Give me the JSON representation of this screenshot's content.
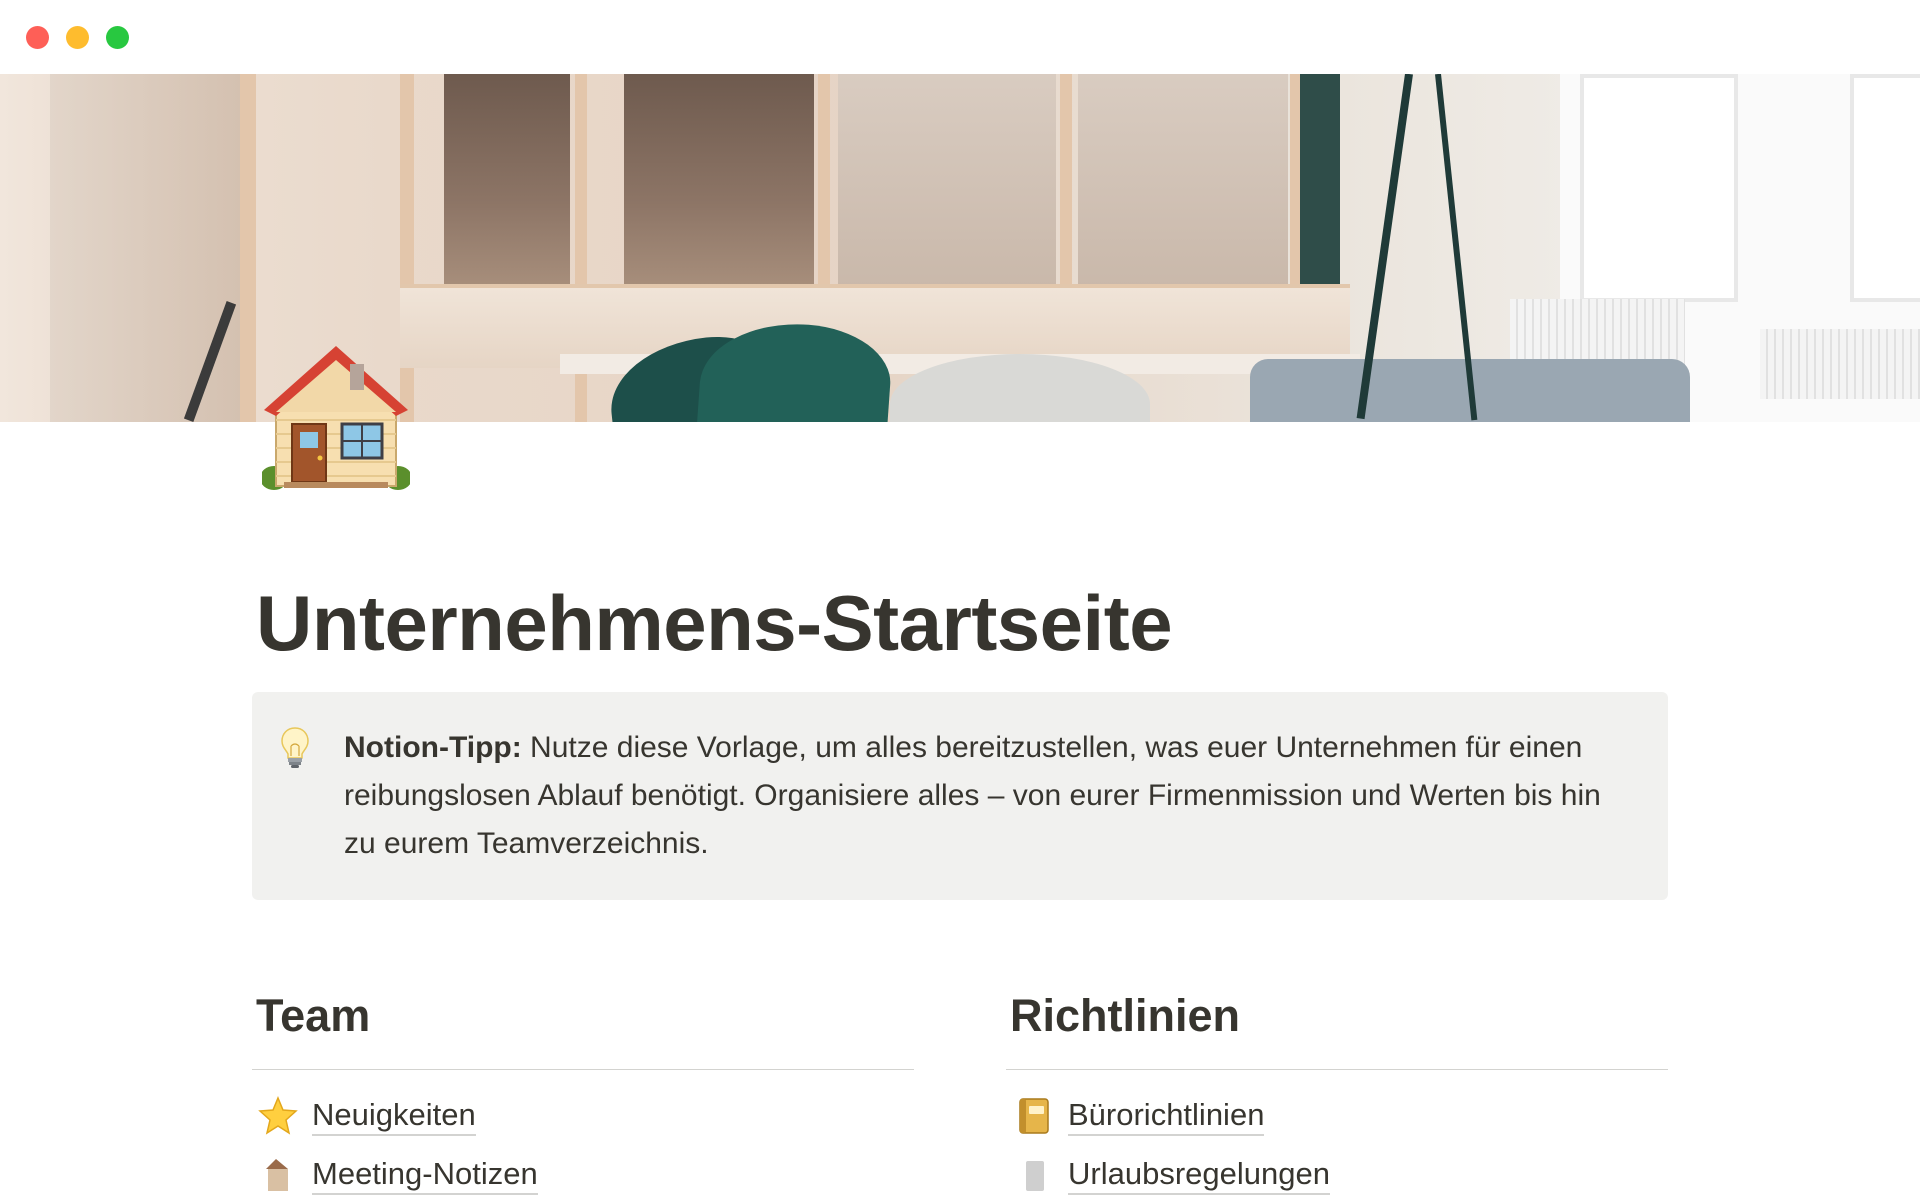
{
  "window": {
    "controls": [
      "close",
      "minimize",
      "zoom"
    ]
  },
  "cover": {
    "description_icon": "office-cover-image"
  },
  "page": {
    "icon": "house-emoji",
    "title": "Unternehmens-Startseite"
  },
  "callout": {
    "icon": "lightbulb-emoji",
    "bold_prefix": "Notion-Tipp:",
    "text": " Nutze diese Vorlage, um alles bereitzustellen, was euer Unternehmen für einen reibungslosen Ablauf benötigt. Organisiere alles – von eurer Firmenmission und Werten bis hin zu eurem Teamverzeichnis."
  },
  "columns": [
    {
      "heading": "Team",
      "items": [
        {
          "icon": "star-emoji",
          "label": "Neuigkeiten"
        },
        {
          "icon": "partial-emoji",
          "label": "Meeting-Notizen"
        }
      ]
    },
    {
      "heading": "Richtlinien",
      "items": [
        {
          "icon": "notebook-emoji",
          "label": "Bürorichtlinien"
        },
        {
          "icon": "partial-emoji",
          "label": "Urlaubsregelungen"
        }
      ]
    }
  ],
  "colors": {
    "text": "#37352f",
    "callout_bg": "#f1f1ef",
    "close": "#fe5f57",
    "minimize": "#febc2e",
    "zoom": "#28c840"
  }
}
